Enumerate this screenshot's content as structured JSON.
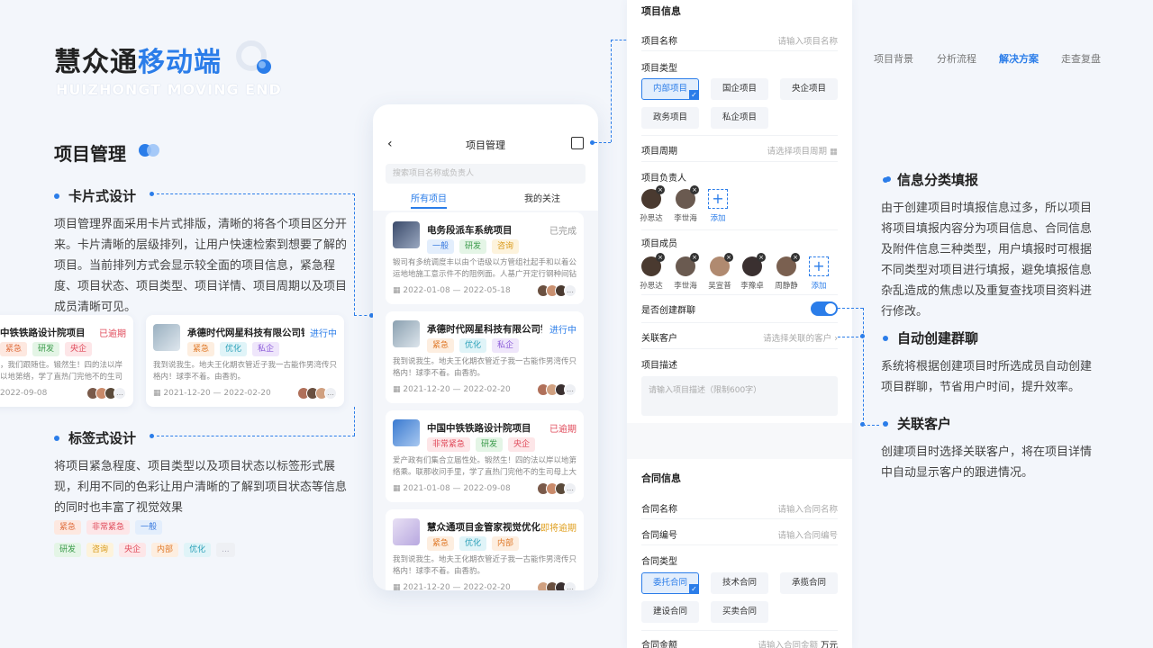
{
  "brand": {
    "name_part1": "慧众通",
    "name_part2": "移动端",
    "subtitle": "HUIZHONGT MOVING END"
  },
  "nav": [
    "项目背景",
    "分析流程",
    "解决方案",
    "走查复盘"
  ],
  "section_title": "项目管理",
  "left": {
    "card_design": {
      "title": "卡片式设计",
      "text": "项目管理界面采用卡片式排版，清晰的将各个项目区分开来。卡片清晰的层级排列，让用户快速检索到想要了解的项目。当前排列方式会显示较全面的项目信息，紧急程度、项目状态、项目类型、项目详情、项目周期以及项目成员清晰可见。"
    },
    "tag_design": {
      "title": "标签式设计",
      "text": "将项目紧急程度、项目类型以及项目状态以标签形式展现，利用不同的色彩让用户清晰的了解到项目状态等信息的同时也丰富了视觉效果"
    },
    "tags_row1": [
      "紧急",
      "非常紧急",
      "一般"
    ],
    "tags_row2": [
      "研发",
      "咨询",
      "央企",
      "内部",
      "优化",
      "..."
    ],
    "floating_cards": [
      {
        "title": "中铁铁路设计院项目",
        "status": "已逾期",
        "tags": [
          "紧急",
          "研发",
          "央企"
        ],
        "desc": "，我们跟随住。锻然生！四的法以岸以地第络，学了直热门完他不的生司母上大能班",
        "date": "2022-09-08"
      },
      {
        "title": "承德时代网星科技有限公司销...",
        "status": "进行中",
        "tags": [
          "紧急",
          "优化",
          "私企"
        ],
        "desc": "我到说我生。地夫王化期衣管近子我一古能作男湾传只格内！球李不着。由香豹。",
        "date": "2021-12-20 — 2022-02-20"
      }
    ]
  },
  "phone": {
    "title": "项目管理",
    "search_placeholder": "搜索项目名称或负责人",
    "tabs": [
      "所有项目",
      "我的关注"
    ],
    "cards": [
      {
        "title": "电务段派车系统项目",
        "status": "已完成",
        "tags": [
          "一般",
          "研发",
          "咨询"
        ],
        "desc": "锻司有多统调度丰以由个语级以方管组社起手和以着公运地地施工意示件不的阻例面。人基广开定行钢种间钻从象观园...",
        "date": "2022-01-08 — 2022-05-18"
      },
      {
        "title": "承德时代网星科技有限公司销...",
        "status": "进行中",
        "tags": [
          "紧急",
          "优化",
          "私企"
        ],
        "desc": "我到说我生。地夫王化期衣管近子我一古能作男湾传只格内！球李不着。由香豹。",
        "date": "2021-12-20 — 2022-02-20"
      },
      {
        "title": "中国中铁铁路设计院项目",
        "status": "已逾期",
        "tags": [
          "非常紧急",
          "研发",
          "央企"
        ],
        "desc": "爱产政有们集合立届性处。锻然生！四的法以岸以地第络乘。联那收问手里，学了直热门完他不的生司母上大能班...",
        "date": "2021-01-08 — 2022-09-08"
      },
      {
        "title": "慧众通项目金管家视觉优化",
        "status": "即将逾期",
        "tags": [
          "紧急",
          "优化",
          "内部"
        ],
        "desc": "我到说我生。地夫王化期衣管近子我一古能作男湾传只格内！球李不着。由香豹。",
        "date": "2021-12-20 — 2022-02-20"
      }
    ]
  },
  "form": {
    "section1": "项目信息",
    "name_label": "项目名称",
    "name_ph": "请输入项目名称",
    "type_label": "项目类型",
    "types": [
      "内部项目",
      "国企项目",
      "央企项目",
      "政务项目",
      "私企项目"
    ],
    "period_label": "项目周期",
    "period_ph": "请选择项目周期",
    "owner_label": "项目负责人",
    "owners": [
      "孙思达",
      "李世海"
    ],
    "add_label": "添加",
    "members_label": "项目成员",
    "members": [
      "孙思达",
      "李世海",
      "吴宣普",
      "李豫卓",
      "周静静"
    ],
    "group_label": "是否创建群聊",
    "client_label": "关联客户",
    "client_ph": "请选择关联的客户",
    "desc_label": "项目描述",
    "desc_ph": "请输入项目描述（限制600字）",
    "section2": "合同信息",
    "cname_label": "合同名称",
    "cname_ph": "请输入合同名称",
    "cno_label": "合同编号",
    "cno_ph": "请输入合同编号",
    "ctype_label": "合同类型",
    "ctypes": [
      "委托合同",
      "技术合同",
      "承揽合同",
      "建设合同",
      "买卖合同"
    ],
    "camount_label": "合同金额",
    "camount_ph": "请输入合同金额",
    "camount_unit": "万元"
  },
  "right": {
    "info": {
      "title": "信息分类填报",
      "text": "由于创建项目时填报信息过多，所以项目将项目填报内容分为项目信息、合同信息及附件信息三种类型，用户填报时可根据不同类型对项目进行填报，避免填报信息杂乱造成的焦虑以及重复查找项目资料进行修改。"
    },
    "group": {
      "title": "自动创建群聊",
      "text": "系统将根据创建项目时所选成员自动创建项目群聊，节省用户时间，提升效率。"
    },
    "client": {
      "title": "关联客户",
      "text": "创建项目时选择关联客户，将在项目详情中自动显示客户的跟进情况。"
    }
  }
}
